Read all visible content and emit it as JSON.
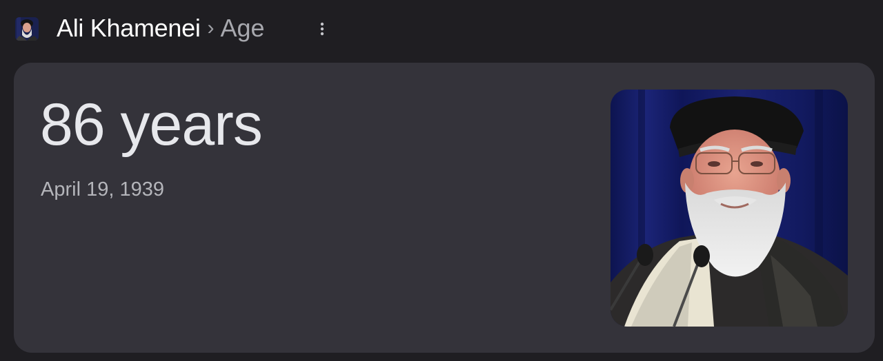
{
  "header": {
    "avatar_icon": "person-avatar",
    "name": "Ali Khamenei",
    "separator": "›",
    "topic": "Age",
    "more_icon": "vertical-ellipsis-icon"
  },
  "card": {
    "age": "86 years",
    "birth_date": "April 19, 1939",
    "photo_icon": "portrait-photo"
  },
  "colors": {
    "page_background": "#1f1e22",
    "card_background": "#34333a",
    "title_text": "#ffffff",
    "secondary_text": "#a7a8ae"
  }
}
